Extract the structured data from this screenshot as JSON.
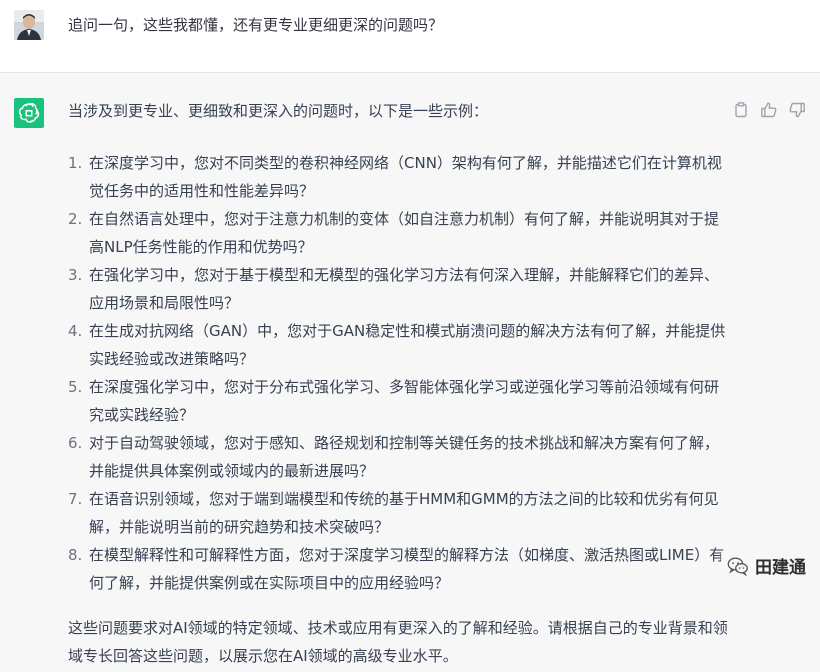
{
  "user_message": {
    "text": "追问一句，这些我都懂，还有更专业更细更深的问题吗？"
  },
  "assistant_message": {
    "intro": "当涉及到更专业、更细致和更深入的问题时，以下是一些示例：",
    "items": [
      {
        "num": "1.",
        "text": "在深度学习中，您对不同类型的卷积神经网络（CNN）架构有何了解，并能描述它们在计算机视觉任务中的适用性和性能差异吗？"
      },
      {
        "num": "2.",
        "text": "在自然语言处理中，您对于注意力机制的变体（如自注意力机制）有何了解，并能说明其对于提高NLP任务性能的作用和优势吗？"
      },
      {
        "num": "3.",
        "text": "在强化学习中，您对于基于模型和无模型的强化学习方法有何深入理解，并能解释它们的差异、应用场景和局限性吗？"
      },
      {
        "num": "4.",
        "text": "在生成对抗网络（GAN）中，您对于GAN稳定性和模式崩溃问题的解决方法有何了解，并能提供实践经验或改进策略吗？"
      },
      {
        "num": "5.",
        "text": "在深度强化学习中，您对于分布式强化学习、多智能体强化学习或逆强化学习等前沿领域有何研究或实践经验？"
      },
      {
        "num": "6.",
        "text": "对于自动驾驶领域，您对于感知、路径规划和控制等关键任务的技术挑战和解决方案有何了解，并能提供具体案例或领域内的最新进展吗？"
      },
      {
        "num": "7.",
        "text": "在语音识别领域，您对于端到端模型和传统的基于HMM和GMM的方法之间的比较和优劣有何见解，并能说明当前的研究趋势和技术突破吗？"
      },
      {
        "num": "8.",
        "text": "在模型解释性和可解释性方面，您对于深度学习模型的解释方法（如梯度、激活热图或LIME）有何了解，并能提供案例或在实际项目中的应用经验吗？"
      }
    ],
    "summary": "这些问题要求对AI领域的特定领域、技术或应用有更深入的了解和经验。请根据自己的专业背景和领域专长回答这些问题，以展示您在AI领域的高级专业水平。"
  },
  "watermark": {
    "text": "田建通"
  },
  "colors": {
    "assistant_brand": "#19c37d",
    "user_bg": "#ffffff",
    "assistant_bg": "#f7f7f8"
  }
}
